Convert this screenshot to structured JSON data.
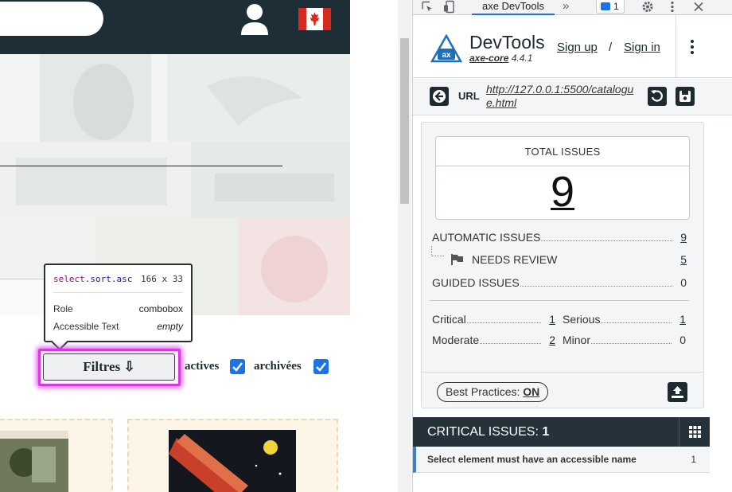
{
  "website": {
    "filter_button_label": "Filtres ⇩",
    "checkboxes": [
      {
        "label": "actives",
        "checked": true
      },
      {
        "label": "archivées",
        "checked": true
      }
    ]
  },
  "inspect_tooltip": {
    "selector_tag": "select",
    "selector_classes": ".sort.asc",
    "size": "166 x 33",
    "role_label": "Role",
    "role_value": "combobox",
    "accessible_text_label": "Accessible Text",
    "accessible_text_value": "empty"
  },
  "devtools_tabs": {
    "active_tab": "axe DevTools",
    "message_count": "1"
  },
  "axe": {
    "title": "DevTools",
    "core_name": "axe-core",
    "core_version": "4.4.1",
    "sign_up": "Sign up",
    "separator": "/",
    "sign_in": "Sign in",
    "url_label": "URL",
    "url": "http://127.0.0.1:5500/catalogue.html",
    "total_issues_label": "TOTAL ISSUES",
    "total_issues": "9",
    "automatic_issues_label": "AUTOMATIC ISSUES",
    "automatic_issues": "9",
    "needs_review_label": "NEEDS REVIEW",
    "needs_review": "5",
    "guided_issues_label": "GUIDED ISSUES",
    "guided_issues": "0",
    "severity": {
      "critical_label": "Critical",
      "critical": "1",
      "serious_label": "Serious",
      "serious": "1",
      "moderate_label": "Moderate",
      "moderate": "2",
      "minor_label": "Minor",
      "minor": "0"
    },
    "best_practices_label": "Best Practices:",
    "best_practices_value": "ON",
    "critical_issues_label": "CRITICAL ISSUES:",
    "critical_issues_count": "1",
    "issues": [
      {
        "text": "Select element must have an accessible name",
        "count": "1"
      }
    ]
  }
}
